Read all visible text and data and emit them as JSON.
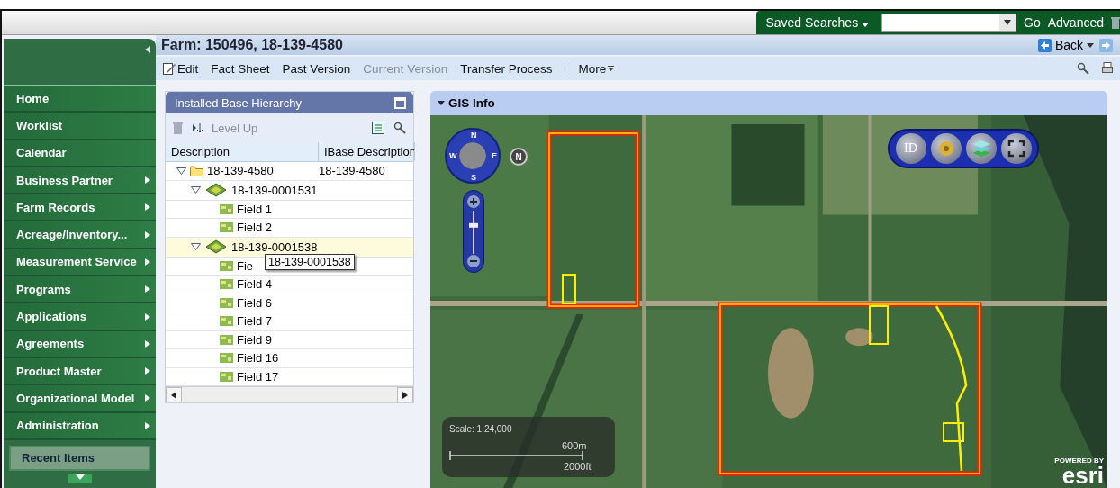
{
  "top_bar": {
    "saved_searches": "Saved Searches",
    "go": "Go",
    "advanced": "Advanced"
  },
  "sidebar": {
    "items": [
      {
        "label": "Home",
        "submenu": false
      },
      {
        "label": "Worklist",
        "submenu": false
      },
      {
        "label": "Calendar",
        "submenu": false
      },
      {
        "label": "Business Partner",
        "submenu": true
      },
      {
        "label": "Farm Records",
        "submenu": true
      },
      {
        "label": "Acreage/Inventory...",
        "submenu": true
      },
      {
        "label": "Measurement Service",
        "submenu": true
      },
      {
        "label": "Programs",
        "submenu": true
      },
      {
        "label": "Applications",
        "submenu": true
      },
      {
        "label": "Agreements",
        "submenu": true
      },
      {
        "label": "Product Master",
        "submenu": true
      },
      {
        "label": "Organizational Model",
        "submenu": true
      },
      {
        "label": "Administration",
        "submenu": true
      }
    ],
    "recent_items": "Recent Items"
  },
  "page": {
    "title": "Farm: 150496, 18-139-4580",
    "back": "Back",
    "toolbar": [
      {
        "label": "Edit",
        "kind": "edit",
        "disabled": false
      },
      {
        "label": "Fact Sheet",
        "kind": "plain",
        "disabled": false
      },
      {
        "label": "Past Version",
        "kind": "plain",
        "disabled": false
      },
      {
        "label": "Current Version",
        "kind": "plain",
        "disabled": true
      },
      {
        "label": "Transfer Process",
        "kind": "plain",
        "disabled": false
      },
      {
        "label": "More",
        "kind": "menu",
        "disabled": false
      }
    ]
  },
  "hierarchy": {
    "title": "Installed Base Hierarchy",
    "level_up": "Level Up",
    "columns": [
      "Description",
      "IBase Description"
    ],
    "rows": [
      {
        "label": "18-139-4580",
        "ibase": "18-139-4580",
        "kind": "folder",
        "expanded": true,
        "selected": false,
        "children": [
          {
            "label": "18-139-0001531",
            "kind": "farm",
            "expanded": true,
            "selected": false,
            "children": [
              {
                "label": "Field 1",
                "kind": "field",
                "selected": false
              },
              {
                "label": "Field 2",
                "kind": "field",
                "selected": false
              }
            ]
          },
          {
            "label": "18-139-0001538",
            "kind": "farm",
            "expanded": true,
            "selected": true,
            "children": [
              {
                "label": "Fie",
                "kind": "field",
                "selected": false
              },
              {
                "label": "Field 4",
                "kind": "field",
                "selected": false
              },
              {
                "label": "Field 6",
                "kind": "field",
                "selected": false
              },
              {
                "label": "Field 7",
                "kind": "field",
                "selected": false
              },
              {
                "label": "Field 9",
                "kind": "field",
                "selected": false
              },
              {
                "label": "Field 16",
                "kind": "field",
                "selected": false
              },
              {
                "label": "Field 17",
                "kind": "field",
                "selected": false
              }
            ]
          }
        ]
      }
    ],
    "tooltip": "18-139-0001538"
  },
  "gis": {
    "title": "GIS Info",
    "zoom": {
      "level": 0.7
    },
    "compass": {
      "n": "N",
      "w": "W",
      "e": "E",
      "s": "S"
    },
    "north_button": "N",
    "id_tool": "ID",
    "scale": "Scale: 1:24,000",
    "scale_m": "600m",
    "scale_ft": "2000ft",
    "logo_tagline": "POWERED BY",
    "logo_name": "esri"
  }
}
